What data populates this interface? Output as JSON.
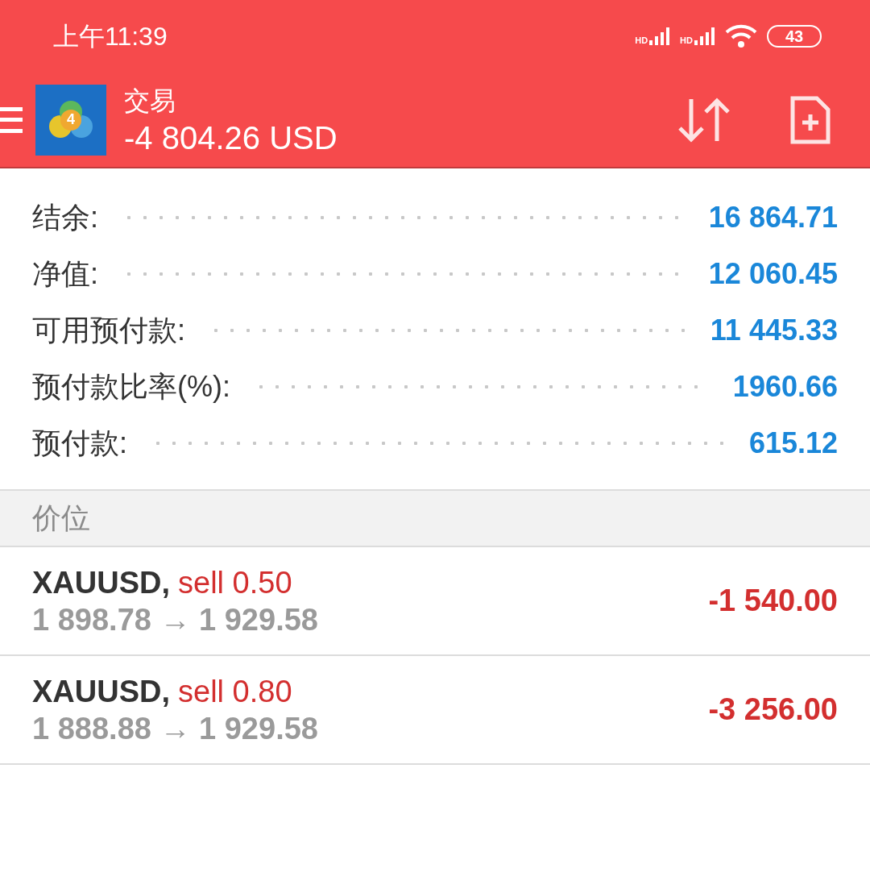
{
  "status_bar": {
    "time": "上午11:39",
    "signals": [
      "HD",
      "HD"
    ],
    "battery": "43"
  },
  "toolbar": {
    "logo_text": "4",
    "title": "交易",
    "balance": "-4 804.26 USD"
  },
  "summary": [
    {
      "label": "结余:",
      "value": "16 864.71"
    },
    {
      "label": "净值:",
      "value": "12 060.45"
    },
    {
      "label": "可用预付款:",
      "value": "11 445.33"
    },
    {
      "label": "预付款比率(%):",
      "value": "1960.66"
    },
    {
      "label": "预付款:",
      "value": "615.12"
    }
  ],
  "section": {
    "title": "价位"
  },
  "positions": [
    {
      "symbol": "XAUUSD,",
      "side": "sell 0.50",
      "prices": "1 898.78 → 1 929.58",
      "profit": "-1 540.00"
    },
    {
      "symbol": "XAUUSD,",
      "side": "sell 0.80",
      "prices": "1 888.88 → 1 929.58",
      "profit": "-3 256.00"
    }
  ]
}
